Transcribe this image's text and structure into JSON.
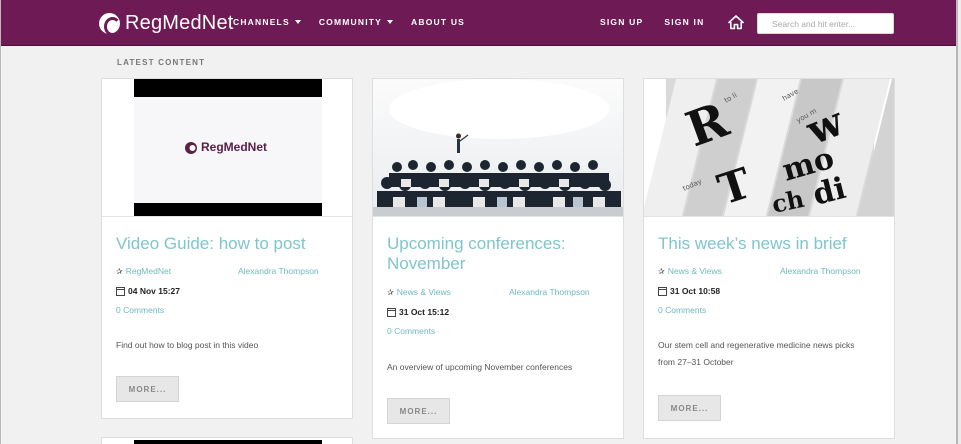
{
  "brand": {
    "name": "RegMedNet",
    "color": "#6e1a55",
    "link_color": "#6fb9c2"
  },
  "nav": {
    "channels": "CHANNELS",
    "community": "COMMUNITY",
    "about": "ABOUT US",
    "sign_up": "SIGN UP",
    "sign_in": "SIGN IN",
    "home_icon": "home-icon"
  },
  "search": {
    "placeholder": "Search and hit enter..."
  },
  "section": {
    "label": "LATEST CONTENT"
  },
  "cards": [
    {
      "image": "regmednet-logo-video-frame",
      "image_text": "RegMedNet",
      "title": "Video Guide: how to post",
      "category": "RegMedNet",
      "author": "Alexandra Thompson",
      "date": "04 Nov 15:27",
      "comments": "0 Comments",
      "excerpt": "Find out how to blog post in this video",
      "more": "MORE..."
    },
    {
      "image": "conference-audience-photo",
      "title": "Upcoming conferences: November",
      "category": "News & Views",
      "author": "Alexandra Thompson",
      "date": "31 Oct 15:12",
      "comments": "0 Comments",
      "excerpt": "An overview of upcoming November conferences",
      "more": "MORE..."
    },
    {
      "image": "newspaper-headlines-photo",
      "title": "This week’s news in brief",
      "category": "News & Views",
      "author": "Alexandra Thompson",
      "date": "31 Oct 10:58",
      "comments": "0 Comments",
      "excerpt_line1": "Our stem cell and regenerative medicine news picks",
      "excerpt_line2": "from 27–31 October",
      "more": "MORE..."
    }
  ]
}
